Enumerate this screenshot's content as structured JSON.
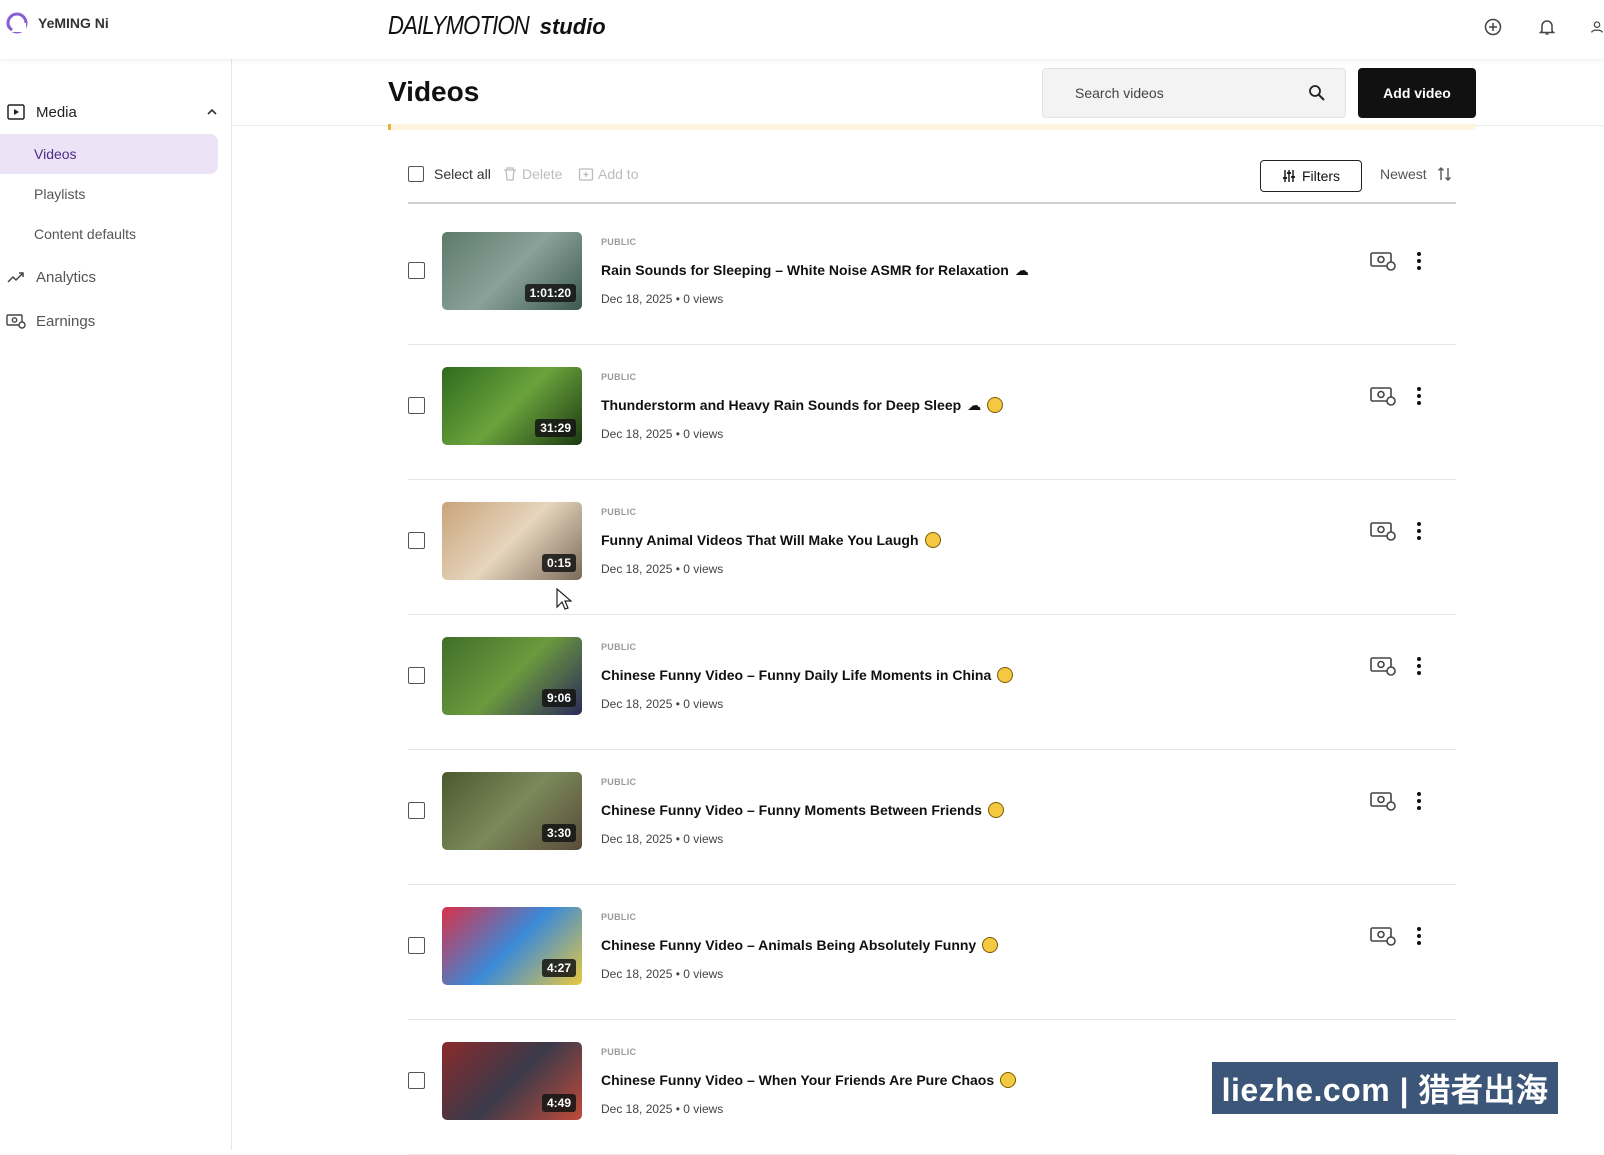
{
  "account": {
    "name": "YeMING Ni"
  },
  "brand": {
    "main": "DAILYMOTION",
    "sub": "studio"
  },
  "topbar": {
    "icons": [
      "add-circle-icon",
      "bell-icon",
      "user-icon"
    ]
  },
  "sidebar": {
    "media_label": "Media",
    "items": [
      {
        "label": "Videos",
        "active": true
      },
      {
        "label": "Playlists",
        "active": false
      },
      {
        "label": "Content defaults",
        "active": false
      }
    ],
    "analytics_label": "Analytics",
    "earnings_label": "Earnings"
  },
  "header": {
    "title": "Videos",
    "search_placeholder": "Search videos",
    "add_label": "Add video"
  },
  "toolbar": {
    "select_all": "Select all",
    "delete": "Delete",
    "add_to": "Add to",
    "filters": "Filters",
    "sort": "Newest"
  },
  "videos": [
    {
      "visibility": "PUBLIC",
      "title": "Rain Sounds for Sleeping – White Noise ASMR for Relaxation",
      "emoji": "cloud-rain",
      "date": "Dec 18, 2025",
      "views": "0 views",
      "duration": "1:01:20",
      "thumb": [
        "#5d7a6a",
        "#8aa19a",
        "#3d5a4e"
      ]
    },
    {
      "visibility": "PUBLIC",
      "title": "Thunderstorm and Heavy Rain Sounds for Deep Sleep",
      "emoji": "cloud-sleep",
      "date": "Dec 18, 2025",
      "views": "0 views",
      "duration": "31:29",
      "thumb": [
        "#2f6a1e",
        "#6aa33c",
        "#1c3a12"
      ]
    },
    {
      "visibility": "PUBLIC",
      "title": "Funny Animal Videos That Will Make You Laugh",
      "emoji": "laugh",
      "date": "Dec 18, 2025",
      "views": "0 views",
      "duration": "0:15",
      "thumb": [
        "#c9a47a",
        "#e6d5bd",
        "#7a6a5a"
      ]
    },
    {
      "visibility": "PUBLIC",
      "title": "Chinese Funny Video – Funny Daily Life Moments in China",
      "emoji": "laugh",
      "date": "Dec 18, 2025",
      "views": "0 views",
      "duration": "9:06",
      "thumb": [
        "#3f6e2a",
        "#6c9a3e",
        "#2a2a5a"
      ]
    },
    {
      "visibility": "PUBLIC",
      "title": "Chinese Funny Video – Funny Moments Between Friends",
      "emoji": "laugh",
      "date": "Dec 18, 2025",
      "views": "0 views",
      "duration": "3:30",
      "thumb": [
        "#4a5a2e",
        "#7a8a5a",
        "#5a4a3a"
      ]
    },
    {
      "visibility": "PUBLIC",
      "title": "Chinese Funny Video – Animals Being Absolutely Funny",
      "emoji": "laugh",
      "date": "Dec 18, 2025",
      "views": "0 views",
      "duration": "4:27",
      "thumb": [
        "#d8304a",
        "#3a8ad8",
        "#e8c840"
      ]
    },
    {
      "visibility": "PUBLIC",
      "title": "Chinese Funny Video – When Your Friends Are Pure Chaos",
      "emoji": "laugh",
      "date": "Dec 18, 2025",
      "views": "0 views",
      "duration": "4:49",
      "thumb": [
        "#8a2a2a",
        "#3a3a4a",
        "#c04a3a"
      ]
    }
  ],
  "watermark": "liezhe.com | 猎者出海"
}
